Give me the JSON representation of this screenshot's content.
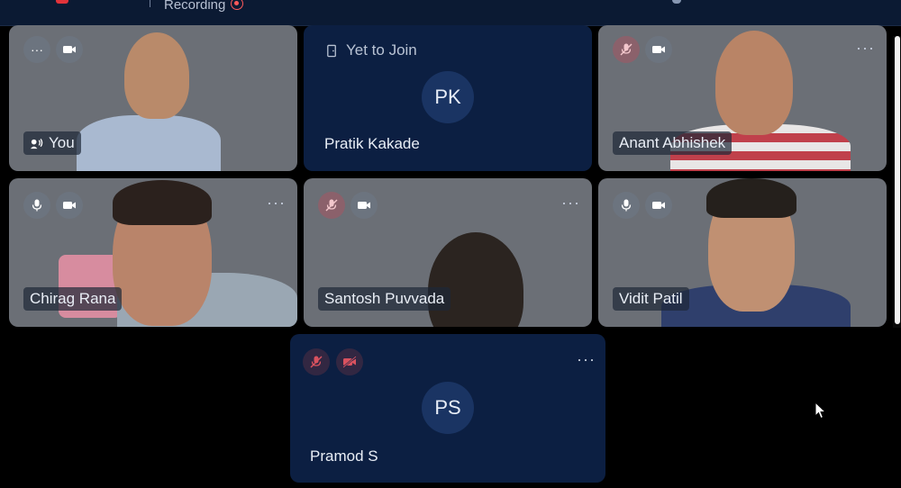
{
  "header": {
    "recording_label": "Recording"
  },
  "tiles": {
    "you": {
      "name": "You"
    },
    "pratik": {
      "status": "Yet to Join",
      "initials": "PK",
      "name": "Pratik Kakade"
    },
    "anant": {
      "name": "Anant Abhishek"
    },
    "chirag": {
      "name": "Chirag Rana"
    },
    "santosh": {
      "name": "Santosh Puvvada"
    },
    "vidit": {
      "name": "Vidit Patil"
    },
    "pramod": {
      "initials": "PS",
      "name": "Pramod S"
    }
  },
  "more_glyph": "···",
  "colors": {
    "tile_dark": "#0c1f42",
    "recording_red": "#ff5a5a",
    "avatar_bg": "#1a3463"
  }
}
